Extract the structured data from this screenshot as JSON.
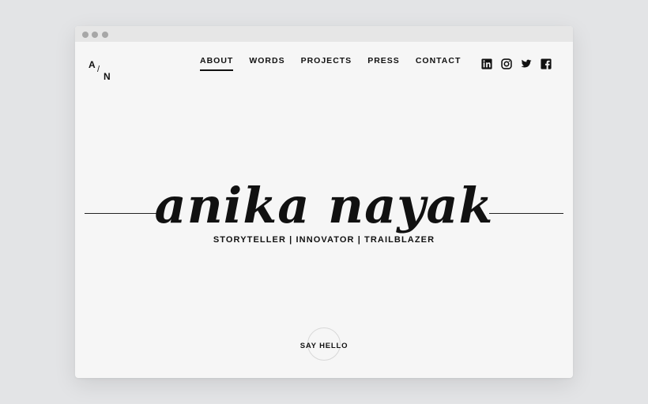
{
  "logo": {
    "a": "A",
    "slash": "/",
    "n": "N"
  },
  "nav": {
    "items": [
      {
        "label": "ABOUT",
        "active": true
      },
      {
        "label": "WORDS"
      },
      {
        "label": "PROJECTS"
      },
      {
        "label": "PRESS"
      },
      {
        "label": "CONTACT"
      }
    ]
  },
  "social": {
    "icons": [
      "linkedin-icon",
      "instagram-icon",
      "twitter-icon",
      "facebook-icon"
    ]
  },
  "hero": {
    "name": "anika nayak",
    "tagline": "STORYTELLER | INNOVATOR | TRAILBLAZER"
  },
  "cta": {
    "label": "SAY HELLO"
  },
  "colors": {
    "background": "#f6f6f6",
    "text": "#111111",
    "frame": "#e3e4e6"
  }
}
